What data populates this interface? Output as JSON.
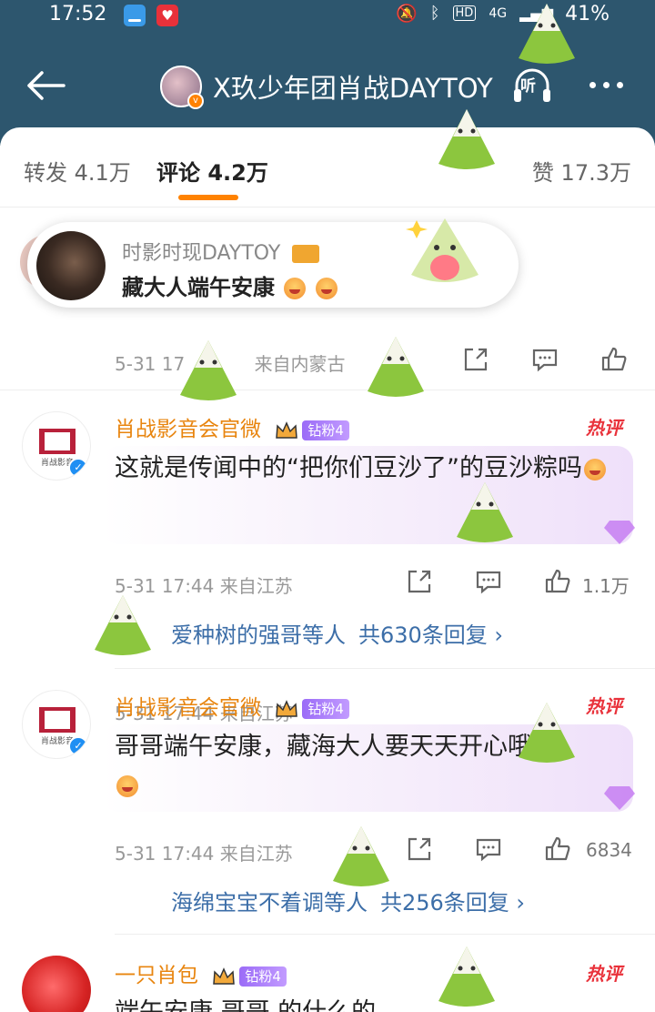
{
  "status_bar": {
    "time": "17:52",
    "battery": "41%",
    "network": "4G",
    "hd": "HD"
  },
  "nav": {
    "title": "X玖少年团肖战DAYTOY",
    "listen_label": "听"
  },
  "tabs": {
    "repost": "转发 4.1万",
    "comment": "评论 4.2万",
    "like": "赞 17.3万"
  },
  "banner": {
    "name": "时影时现DAYTOY",
    "text": "藏大人端午安康"
  },
  "first_comment_meta": {
    "date": "5-31 17",
    "location": "来自内蒙古"
  },
  "comments": [
    {
      "name": "肖战影音会官微",
      "fan_badge": "钻粉4",
      "hot_tag": "热评",
      "avatar_text": "肖战影音",
      "text": "这就是传闻中的“把你们豆沙了”的豆沙粽吗",
      "meta": "5-31 17:44 来自江苏",
      "likes": "1.1万",
      "reply_user": "爱种树的强哥等人",
      "reply_count": "共630条回复 ›"
    },
    {
      "name": "肖战影音会官微",
      "fan_badge": "钻粉4",
      "hot_tag": "热评",
      "avatar_text": "肖战影音",
      "text": "哥哥端午安康，藏海大人要天天开心哦",
      "meta": "5-31 17:44 来自江苏",
      "likes": "6834",
      "reply_user": "海绵宝宝不着调等人",
      "reply_count": "共256条回复 ›"
    },
    {
      "name": "一只肖包",
      "fan_badge": "钻粉4",
      "hot_tag": "热评",
      "text": "端午安康 哥哥 的什么的"
    }
  ],
  "colors": {
    "header_bg": "#2d566e",
    "accent": "#ff8200",
    "name_color": "#e8850f",
    "hot_color": "#e9323b",
    "link_color": "#3c6ea8"
  },
  "icons": [
    "back-arrow-icon",
    "headphone-icon",
    "more-icon",
    "share-icon",
    "comment-icon",
    "like-icon",
    "crown-icon",
    "diamond-icon",
    "zongzi-mascot-icon",
    "verified-icon"
  ]
}
